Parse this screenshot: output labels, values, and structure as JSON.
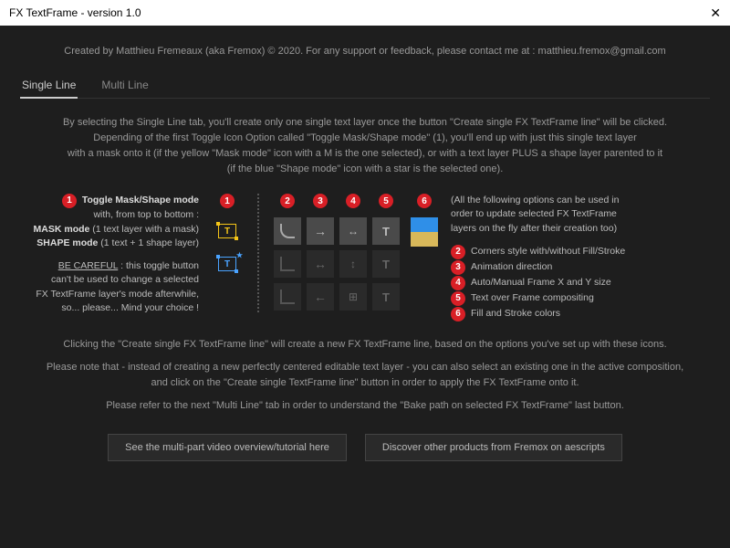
{
  "window": {
    "title": "FX TextFrame - version 1.0",
    "close": "✕"
  },
  "credit": "Created by Matthieu Fremeaux (aka Fremox) © 2020. For any support or feedback, please contact me at : matthieu.fremox@gmail.com",
  "tabs": {
    "single": "Single Line",
    "multi": "Multi Line"
  },
  "intro": {
    "l1": "By selecting the Single Line tab, you'll create only one single text layer once the button \"Create single FX TextFrame line\" will be clicked.",
    "l2": "Depending of the first Toggle Icon Option called \"Toggle Mask/Shape mode\" (1), you'll end up with just this single text layer",
    "l3": "with a mask onto it (if the yellow \"Mask mode\" icon with a M is the one selected), or with a text layer PLUS a shape layer parented to it",
    "l4": "(if the blue \"Shape mode\" icon with a star is the selected one)."
  },
  "left": {
    "title": "Toggle Mask/Shape mode",
    "sub1": "with, from top to bottom :",
    "mask_bold": "MASK mode",
    "mask_rest": " (1 text layer with a mask)",
    "shape_bold": "SHAPE mode",
    "shape_rest": " (1 text + 1 shape layer)",
    "careful": "BE CAREFUL",
    "careful_rest": " : this toggle button",
    "w1": "can't be used to change a selected",
    "w2": "FX TextFrame layer's mode afterwhile,",
    "w3": "so... please... Mind your choice !"
  },
  "badges": {
    "b1": "1",
    "b2": "2",
    "b3": "3",
    "b4": "4",
    "b5": "5",
    "b6": "6"
  },
  "right": {
    "intro1": "(All the following options can be used in",
    "intro2": "order to update selected FX TextFrame",
    "intro3": "layers on the fly after their creation too)",
    "i2": "Corners style with/without Fill/Stroke",
    "i3": "Animation direction",
    "i4": "Auto/Manual Frame X and Y size",
    "i5": "Text over Frame compositing",
    "i6": "Fill and Stroke colors"
  },
  "notes": {
    "n1": "Clicking the \"Create single FX TextFrame line\" will create a new FX TextFrame line, based on the options you've set up with these icons.",
    "n2a": "Please note that - instead of creating a new perfectly centered editable text layer - you can also select an existing one in the active composition,",
    "n2b": "and click on the \"Create single TextFrame line\" button in order to apply the FX TextFrame onto it.",
    "n3": "Please refer to the next \"Multi Line\" tab in order to understand the \"Bake path on selected FX TextFrame\" last button."
  },
  "footer": {
    "video": "See the multi-part video overview/tutorial here",
    "products": "Discover other products from Fremox on aescripts"
  },
  "icons": {
    "T": "T"
  }
}
